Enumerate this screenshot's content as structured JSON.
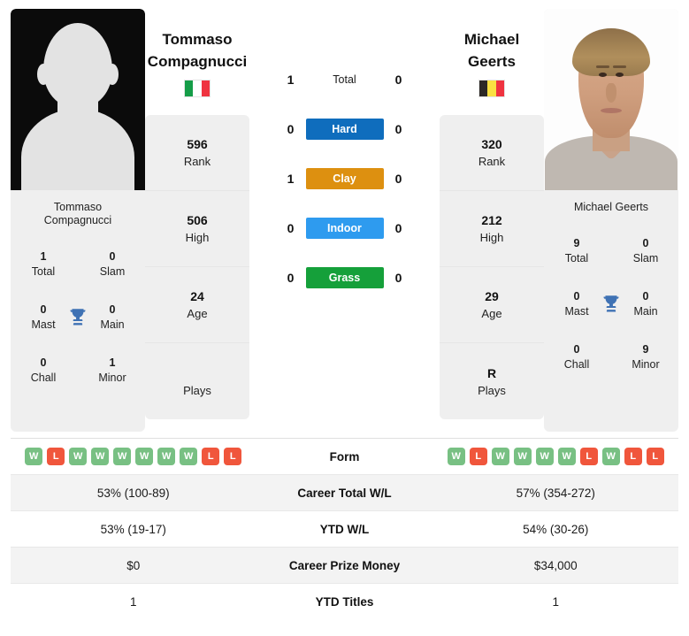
{
  "colors": {
    "win": "#78c083",
    "loss": "#f0563c",
    "hard": "#0f6dbd",
    "clay": "#dd9010",
    "indoor": "#2e9bef",
    "grass": "#15a03a",
    "trophy": "#3f72b4"
  },
  "left_player": {
    "name_line1": "Tommaso",
    "name_line2": "Compagnucci",
    "photo_caption_line1": "Tommaso",
    "photo_caption_line2": "Compagnucci",
    "flag_name": "italy-flag",
    "flag_colors": [
      "#159d48",
      "#ffffff",
      "#ef3340"
    ],
    "titles": [
      {
        "value": "1",
        "label": "Total"
      },
      {
        "value": "0",
        "label": "Slam"
      },
      {
        "value": "0",
        "label": "Mast"
      },
      {
        "value": "0",
        "label": "Main"
      },
      {
        "value": "0",
        "label": "Chall"
      },
      {
        "value": "1",
        "label": "Minor"
      }
    ],
    "info": [
      {
        "value": "596",
        "label": "Rank"
      },
      {
        "value": "506",
        "label": "High"
      },
      {
        "value": "24",
        "label": "Age"
      },
      {
        "value": "",
        "label": "Plays"
      }
    ],
    "form": [
      "W",
      "L",
      "W",
      "W",
      "W",
      "W",
      "W",
      "W",
      "L",
      "L"
    ],
    "career_wl": "53% (100-89)",
    "ytd_wl": "53% (19-17)",
    "prize_money": "$0",
    "ytd_titles": "1"
  },
  "right_player": {
    "name_line1": "Michael",
    "name_line2": "Geerts",
    "photo_caption_line1": "Michael Geerts",
    "photo_caption_line2": "",
    "flag_name": "belgium-flag",
    "flag_colors": [
      "#2d2926",
      "#fae042",
      "#ef3340"
    ],
    "titles": [
      {
        "value": "9",
        "label": "Total"
      },
      {
        "value": "0",
        "label": "Slam"
      },
      {
        "value": "0",
        "label": "Mast"
      },
      {
        "value": "0",
        "label": "Main"
      },
      {
        "value": "0",
        "label": "Chall"
      },
      {
        "value": "9",
        "label": "Minor"
      }
    ],
    "info": [
      {
        "value": "320",
        "label": "Rank"
      },
      {
        "value": "212",
        "label": "High"
      },
      {
        "value": "29",
        "label": "Age"
      },
      {
        "value": "R",
        "label": "Plays"
      }
    ],
    "form": [
      "W",
      "L",
      "W",
      "W",
      "W",
      "W",
      "L",
      "W",
      "L",
      "L"
    ],
    "career_wl": "57% (354-272)",
    "ytd_wl": "54% (30-26)",
    "prize_money": "$34,000",
    "ytd_titles": "1"
  },
  "surfaces": [
    {
      "label": "Total",
      "left": "1",
      "right": "0",
      "style": "plain"
    },
    {
      "label": "Hard",
      "left": "0",
      "right": "0",
      "style": "hard"
    },
    {
      "label": "Clay",
      "left": "1",
      "right": "0",
      "style": "clay"
    },
    {
      "label": "Indoor",
      "left": "0",
      "right": "0",
      "style": "indoor"
    },
    {
      "label": "Grass",
      "left": "0",
      "right": "0",
      "style": "grass"
    }
  ],
  "table": {
    "form_label": "Form",
    "career_label": "Career Total W/L",
    "ytd_wl_label": "YTD W/L",
    "prize_label": "Career Prize Money",
    "titles_label": "YTD Titles"
  }
}
